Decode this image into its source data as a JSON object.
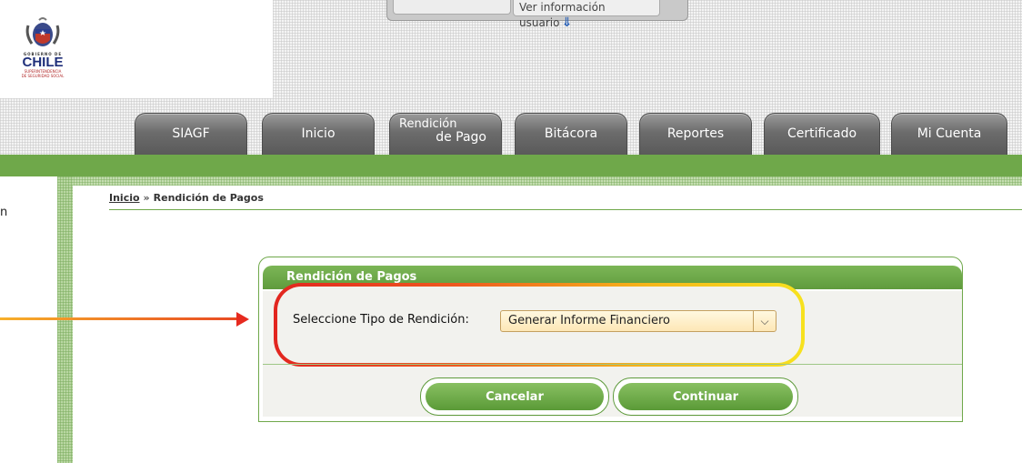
{
  "header": {
    "logo": {
      "gobierno": "GOBIERNO DE",
      "country": "CHILE",
      "agency_line1": "SUPERINTENDENCIA",
      "agency_line2": "DE SEGURIDAD SOCIAL"
    },
    "user_info_label": "Ver información usuario"
  },
  "nav": {
    "tabs": [
      {
        "label": "SIAGF"
      },
      {
        "label": "Inicio"
      },
      {
        "label_line1": "Rendición",
        "label_line2": "de Pago"
      },
      {
        "label": "Bitácora"
      },
      {
        "label": "Reportes"
      },
      {
        "label": "Certificado"
      },
      {
        "label": "Mi Cuenta"
      }
    ]
  },
  "sidebar": {
    "partial_text": "n"
  },
  "breadcrumb": {
    "home": "Inicio",
    "separator": "»",
    "current": "Rendición de Pagos"
  },
  "panel": {
    "title": "Rendición de Pagos",
    "select_label": "Seleccione Tipo de Rendición:",
    "select_value": "Generar Informe Financiero",
    "cancel_label": "Cancelar",
    "continue_label": "Continuar"
  },
  "colors": {
    "brand_green": "#6fa84a",
    "tab_gray": "#6c6c6c",
    "highlight_red": "#e2251f",
    "highlight_yellow": "#f7e21e"
  }
}
